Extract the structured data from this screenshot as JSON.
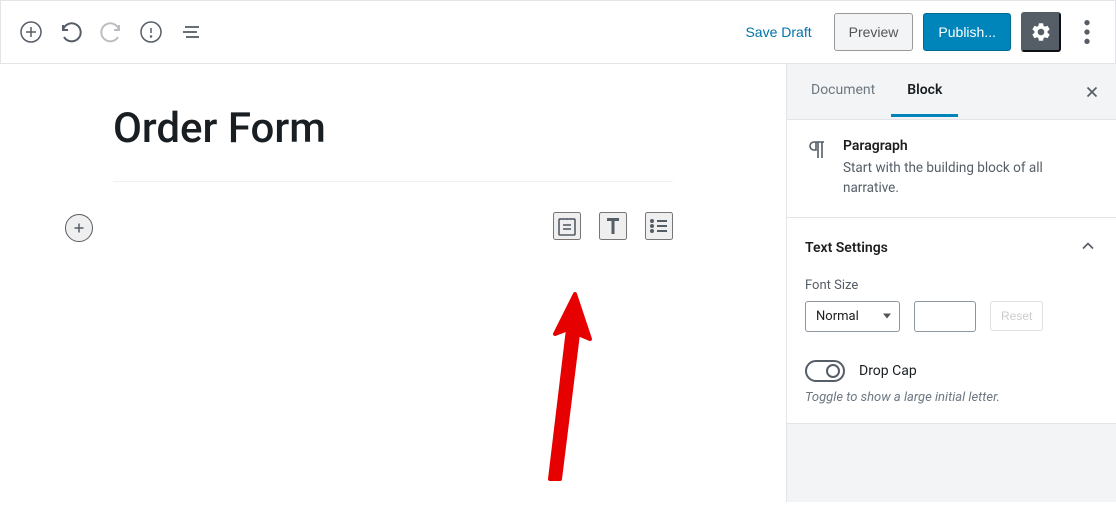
{
  "toolbar": {
    "save_draft": "Save Draft",
    "preview": "Preview",
    "publish": "Publish..."
  },
  "editor": {
    "title": "Order Form"
  },
  "sidebar": {
    "tabs": {
      "document": "Document",
      "block": "Block"
    },
    "block_info": {
      "name": "Paragraph",
      "description": "Start with the building block of all narrative."
    },
    "text_settings": {
      "title": "Text Settings",
      "font_size_label": "Font Size",
      "font_size_value": "Normal",
      "reset": "Reset",
      "drop_cap_label": "Drop Cap",
      "drop_cap_help": "Toggle to show a large initial letter."
    }
  }
}
